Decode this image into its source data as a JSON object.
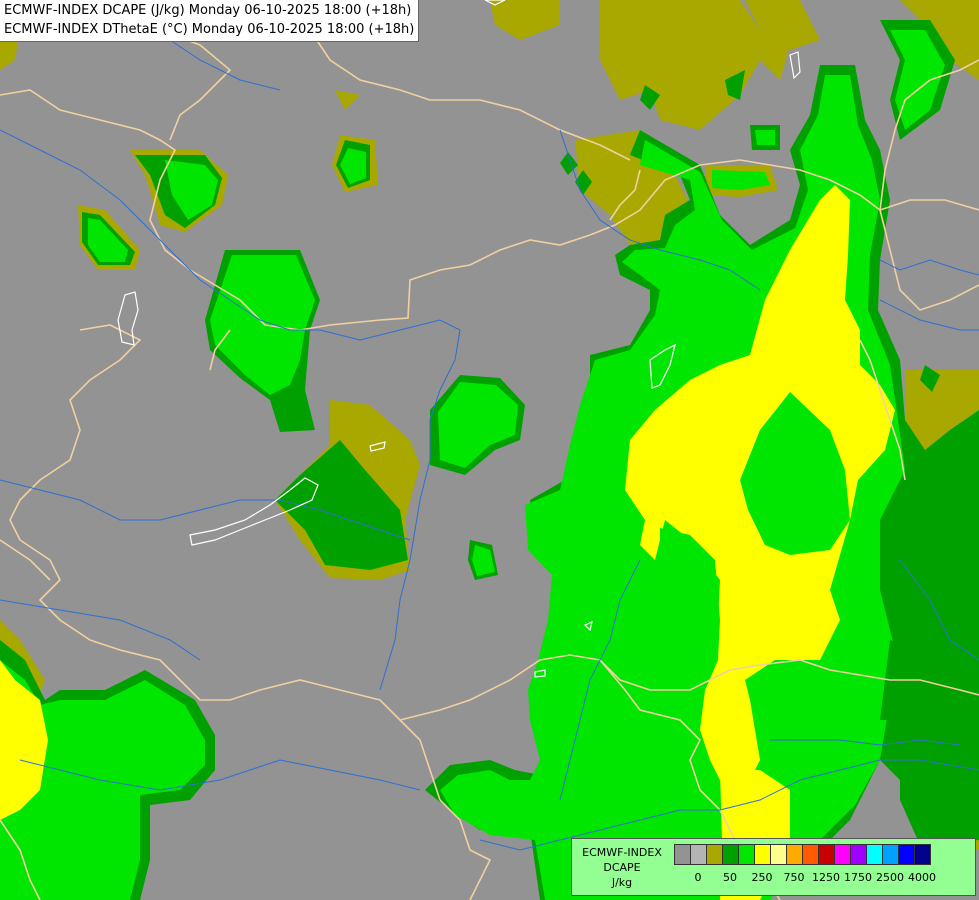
{
  "header": {
    "line1": "ECMWF-INDEX DCAPE (J/kg) Monday 06-10-2025 18:00 (+18h)",
    "line2": "ECMWF-INDEX DThetaE (°C) Monday 06-10-2025 18:00 (+18h)"
  },
  "legend": {
    "title_line1": "ECMWF-INDEX",
    "title_line2": "DCAPE",
    "unit": "J/kg",
    "colors": [
      "#939393",
      "#b4b4b4",
      "#a8a800",
      "#00a000",
      "#00e600",
      "#ffff00",
      "#ffff8c",
      "#ffaa00",
      "#ff5a00",
      "#c80000",
      "#ff00ff",
      "#a000ff",
      "#00ffff",
      "#00a0ff",
      "#0000ff",
      "#00008c"
    ],
    "tick_labels": [
      "0",
      "50",
      "250",
      "750",
      "1250",
      "1750",
      "2500",
      "4000"
    ]
  },
  "palette": {
    "background": "#939393",
    "olive": "#a8a800",
    "dark_green": "#00a000",
    "green": "#00e600",
    "yellow": "#ffff00",
    "border_line": "#f0d0a0",
    "river_line": "#2f6fd0",
    "lake_line": "#ffffff"
  }
}
